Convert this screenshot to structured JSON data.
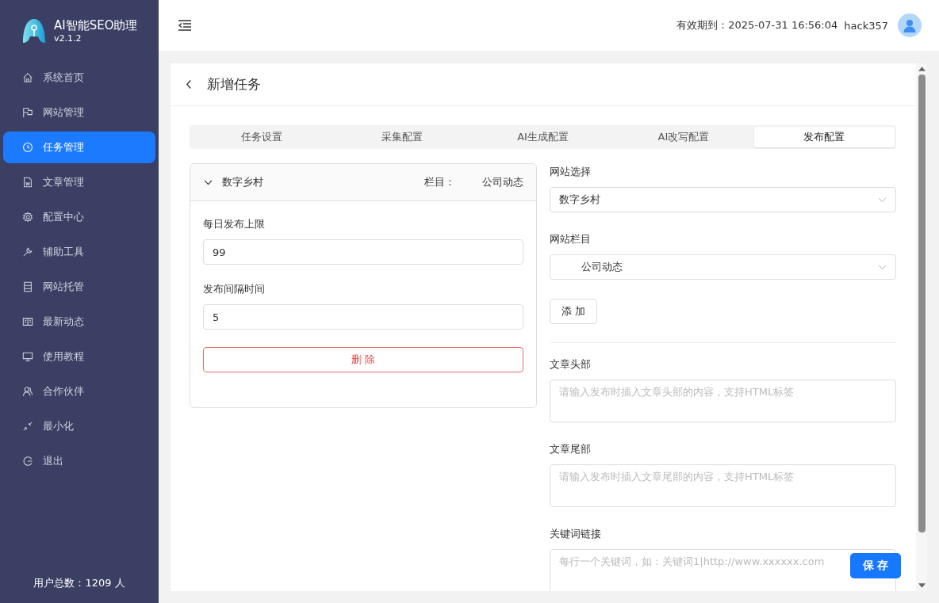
{
  "app": {
    "name": "AI智能SEO助理",
    "version": "v2.1.2"
  },
  "sidebar": {
    "items": [
      {
        "label": "系统首页",
        "selected": false
      },
      {
        "label": "网站管理",
        "selected": false
      },
      {
        "label": "任务管理",
        "selected": true
      },
      {
        "label": "文章管理",
        "selected": false
      },
      {
        "label": "配置中心",
        "selected": false
      },
      {
        "label": "辅助工具",
        "selected": false
      },
      {
        "label": "网站托管",
        "selected": false
      },
      {
        "label": "最新动态",
        "selected": false
      },
      {
        "label": "使用教程",
        "selected": false
      },
      {
        "label": "合作伙伴",
        "selected": false
      },
      {
        "label": "最小化",
        "selected": false
      },
      {
        "label": "退出",
        "selected": false
      }
    ],
    "footer": "用户总数：1209 人"
  },
  "header": {
    "expiry": "有效期到：2025-07-31 16:56:04",
    "user": "hack357"
  },
  "page": {
    "title": "新增任务"
  },
  "tabs": [
    {
      "label": "任务设置",
      "selected": false
    },
    {
      "label": "采集配置",
      "selected": false
    },
    {
      "label": "AI生成配置",
      "selected": false
    },
    {
      "label": "AI改写配置",
      "selected": false
    },
    {
      "label": "发布配置",
      "selected": true
    }
  ],
  "site_card": {
    "name": "数字乡村",
    "expanded": true,
    "column_label": "栏目：",
    "column_value": "公司动态",
    "fields": [
      {
        "label": "每日发布上限",
        "value": "99"
      },
      {
        "label": "发布间隔时间",
        "value": "5"
      }
    ],
    "delete_button": "删 除"
  },
  "form": {
    "site_select": {
      "label": "网站选择",
      "value": "数字乡村"
    },
    "column_select": {
      "label": "网站栏目",
      "value": "公司动态"
    },
    "add_button": "添 加",
    "header_text": {
      "label": "文章头部",
      "placeholder": "请输入发布时插入文章头部的内容，支持HTML标签"
    },
    "footer_text": {
      "label": "文章尾部",
      "placeholder": "请输入发布时插入文章尾部的内容，支持HTML标签"
    },
    "keyword_links": {
      "label": "关键词链接",
      "placeholder": "每行一个关键词，如：关键词1|http://www.xxxxxx.com"
    },
    "save_button": "保 存"
  }
}
